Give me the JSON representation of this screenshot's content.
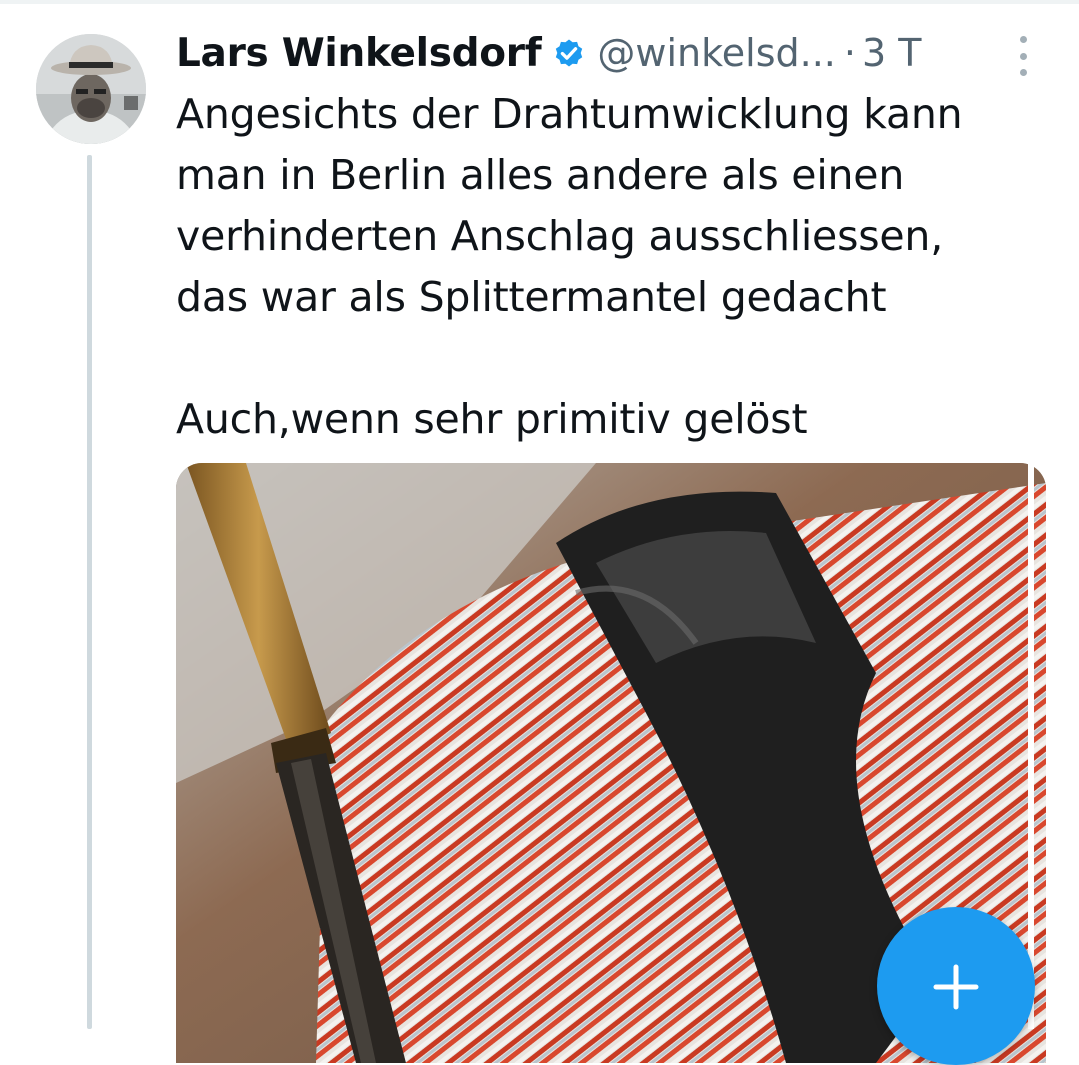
{
  "tweet": {
    "author_name": "Lars Winkelsdorf",
    "handle": "@winkelsd...",
    "separator": "·",
    "time": "3 T",
    "text": "Angesichts der Drahtumwicklung kann\nman in Berlin alles andere als einen\nverhinderten Anschlag ausschliessen,\ndas war als Splittermantel gedacht\n\nAuch,wenn sehr primitiv gelöst"
  },
  "icons": {
    "verified": "verified-badge-icon",
    "more": "more-options-icon",
    "compose": "plus-icon"
  },
  "colors": {
    "accent": "#1d9bf0",
    "secondary_text": "#536471",
    "thread_line": "#cfd9de"
  }
}
